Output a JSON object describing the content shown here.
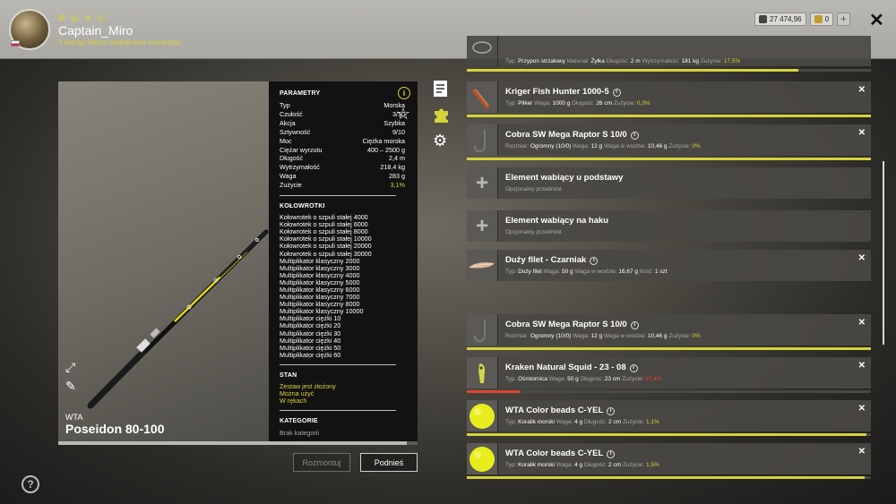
{
  "header": {
    "level": "45",
    "rank_level": "57",
    "username": "Captain_Miro",
    "rank_title": "3 Ranga Mistrz wędkarstwa morskiego",
    "silver": "27 474,96",
    "gold": "0"
  },
  "rod": {
    "brand": "WTA",
    "name": "Poseidon 80-100"
  },
  "params": {
    "title": "PARAMETRY",
    "rows": [
      {
        "k": "Typ",
        "v": "Morska"
      },
      {
        "k": "Czułość",
        "v": "3/10"
      },
      {
        "k": "Akcja",
        "v": "Szybka"
      },
      {
        "k": "Sztywność",
        "v": "9/10"
      },
      {
        "k": "Moc",
        "v": "Ciężka morska"
      },
      {
        "k": "Ciężar wyrzutu",
        "v": "400 – 2500 g"
      },
      {
        "k": "Długość",
        "v": "2,4 m"
      },
      {
        "k": "Wytrzymałość",
        "v": "218,4 kg"
      },
      {
        "k": "Waga",
        "v": "283 g"
      },
      {
        "k": "Zużycie",
        "v": "3,1%"
      }
    ],
    "reels_title": "KOŁOWROTKI",
    "reels": [
      "Kołowrotek o szpuli stałej 4000",
      "Kołowrotek o szpuli stałej 6000",
      "Kołowrotek o szpuli stałej 8000",
      "Kołowrotek o szpuli stałej 10000",
      "Kołowrotek o szpuli stałej 20000",
      "Kołowrotek o szpuli stałej 30000",
      "Multiplikator klasyczny 2000",
      "Multiplikator klasyczny 3000",
      "Multiplikator klasyczny 4000",
      "Multiplikator klasyczny 5000",
      "Multiplikator klasyczny 6000",
      "Multiplikator klasyczny 7000",
      "Multiplikator klasyczny 8000",
      "Multiplikator klasyczny 10000",
      "Multiplikator ciężki 10",
      "Multiplikator ciężki 20",
      "Multiplikator ciężki 30",
      "Multiplikator ciężki 40",
      "Multiplikator ciężki 50",
      "Multiplikator ciężki 60"
    ],
    "state_title": "STAN",
    "states": [
      "Zestaw jest złożony",
      "Można użyć",
      "W rękach"
    ],
    "category_title": "KATEGORIE",
    "category": "Brak kategorii"
  },
  "buttons": {
    "disassemble": "Rozmontuj",
    "pickup": "Podnieś"
  },
  "colors": {
    "accent": "#d6d23a",
    "wear_bad": "#e0462f"
  },
  "items": [
    {
      "name": "",
      "desc": [
        [
          "Typ: ",
          "Przypon strzałowy"
        ],
        [
          "Materiał: ",
          "Żyłka"
        ],
        [
          "Długość: ",
          "2 m"
        ],
        [
          "Wytrzymałość: ",
          "181 kg"
        ],
        [
          "Zużycie: ",
          "17,5%"
        ]
      ],
      "wear": 0.82,
      "wear_color": "#d6d23a",
      "thumb": "leader",
      "closable": false
    },
    {
      "name": "Kriger Fish Hunter 1000-5",
      "desc": [
        [
          "Typ: ",
          "Pilker"
        ],
        [
          "Waga: ",
          "1000 g"
        ],
        [
          "Długość: ",
          "26 cm"
        ],
        [
          "Zużycie: ",
          "0,3%"
        ]
      ],
      "wear": 1.0,
      "wear_color": "#d6d23a",
      "thumb": "pilker",
      "closable": true
    },
    {
      "name": "Cobra SW Mega Raptor S 10/0",
      "desc": [
        [
          "Rozmiar: ",
          "Ogromny (10/0)"
        ],
        [
          "Waga: ",
          "12 g"
        ],
        [
          "Waga w wodzie: ",
          "10,46 g"
        ],
        [
          "Zużycie: ",
          "0%"
        ]
      ],
      "wear": 1.0,
      "wear_color": "#d6d23a",
      "thumb": "hook",
      "closable": true
    },
    {
      "name": "Element wabiący u podstawy",
      "optional": "Opcjonalny przedmiot",
      "thumb": "plus",
      "closable": false,
      "wear": null
    },
    {
      "name": "Element wabiący na haku",
      "optional": "Opcjonalny przedmiot",
      "thumb": "plus",
      "closable": false,
      "wear": null
    },
    {
      "name": "Duży filet - Czarniak",
      "desc": [
        [
          "Typ: ",
          "Duży filet"
        ],
        [
          "Waga: ",
          "50 g"
        ],
        [
          "Waga w wodzie: ",
          "16,67 g"
        ],
        [
          "Ilość: ",
          "1 szt"
        ]
      ],
      "thumb": "filet",
      "closable": true,
      "wear": null
    },
    {
      "name": "Cobra SW Mega Raptor S 10/0",
      "desc": [
        [
          "Rozmiar: ",
          "Ogromny (10/0)"
        ],
        [
          "Waga: ",
          "12 g"
        ],
        [
          "Waga w wodzie: ",
          "10,46 g"
        ],
        [
          "Zużycie: ",
          "0%"
        ]
      ],
      "wear": 1.0,
      "wear_color": "#d6d23a",
      "thumb": "hook",
      "closable": true
    },
    {
      "name": "Kraken Natural Squid - 23 - 08",
      "desc": [
        [
          "Typ: ",
          "Ośmiornica"
        ],
        [
          "Waga: ",
          "50 g"
        ],
        [
          "Długość: ",
          "23 cm"
        ],
        [
          "Zużycie: ",
          "87,4%"
        ]
      ],
      "wear": 0.13,
      "wear_color": "#e0462f",
      "thumb": "squid",
      "closable": true,
      "bad": true
    },
    {
      "name": "WTA Color beads C-YEL",
      "desc": [
        [
          "Typ: ",
          "Koralik morski"
        ],
        [
          "Waga: ",
          "4 g"
        ],
        [
          "Długość: ",
          "2 cm"
        ],
        [
          "Zużycie: ",
          "1,1%"
        ]
      ],
      "wear": 0.99,
      "wear_color": "#d6d23a",
      "thumb": "bead",
      "closable": true
    },
    {
      "name": "WTA Color beads C-YEL",
      "desc": [
        [
          "Typ: ",
          "Koralik morski"
        ],
        [
          "Waga: ",
          "4 g"
        ],
        [
          "Długość: ",
          "2 cm"
        ],
        [
          "Zużycie: ",
          "1,5%"
        ]
      ],
      "wear": 0.985,
      "wear_color": "#d6d23a",
      "thumb": "bead",
      "closable": true
    }
  ]
}
